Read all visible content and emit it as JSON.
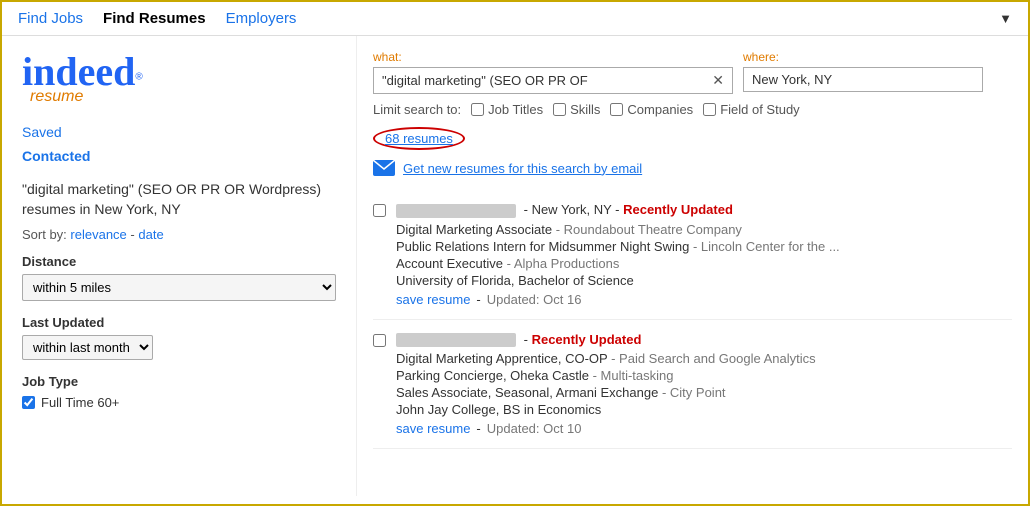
{
  "nav": {
    "find_jobs": "Find Jobs",
    "find_resumes": "Find Resumes",
    "employers": "Employers"
  },
  "sidebar": {
    "logo_indeed": "indeed",
    "logo_tm": "®",
    "logo_resume": "resume",
    "saved_label": "Saved",
    "contacted_label": "Contacted",
    "search_desc": "\"digital marketing\" (SEO OR PR OR Wordpress) resumes in New York, NY",
    "sort_label": "Sort by:",
    "sort_relevance": "relevance",
    "sort_dash": "-",
    "sort_date": "date",
    "distance_label": "Distance",
    "distance_option": "within 5 miles",
    "last_updated_label": "Last Updated",
    "last_updated_option": "within last month",
    "job_type_label": "Job Type",
    "full_time_label": "Full Time 60+"
  },
  "search": {
    "what_label": "what:",
    "where_label": "where:",
    "what_value": "\"digital marketing\" (SEO OR PR OF",
    "where_value": "New York, NY",
    "limit_label": "Limit search to:",
    "job_titles_label": "Job Titles",
    "skills_label": "Skills",
    "companies_label": "Companies",
    "field_of_study_label": "Field of Study",
    "result_count": "68 resumes",
    "email_alert_text": "Get new resumes for this search by email"
  },
  "resumes": [
    {
      "id": 1,
      "location": "New York, NY",
      "recently_updated": "Recently Updated",
      "line1_title": "Digital Marketing Associate",
      "line1_company": "Roundabout Theatre Company",
      "line2_title": "Public Relations Intern for Midsummer Night Swing",
      "line2_company": "Lincoln Center for the ...",
      "line3_title": "Account Executive",
      "line3_company": "Alpha Productions",
      "line4": "University of Florida, Bachelor of Science",
      "save_label": "save resume",
      "updated_text": "Updated: Oct 16"
    },
    {
      "id": 2,
      "location": "",
      "recently_updated": "Recently Updated",
      "line1_title": "Digital Marketing Apprentice, CO-OP",
      "line1_company": "Paid Search and Google Analytics",
      "line2_title": "Parking Concierge, Oheka Castle",
      "line2_company": "Multi-tasking",
      "line3_title": "Sales Associate, Seasonal, Armani Exchange",
      "line3_company": "City Point",
      "line4": "John Jay College, BS in Economics",
      "save_label": "save resume",
      "updated_text": "Updated: Oct 10"
    }
  ]
}
